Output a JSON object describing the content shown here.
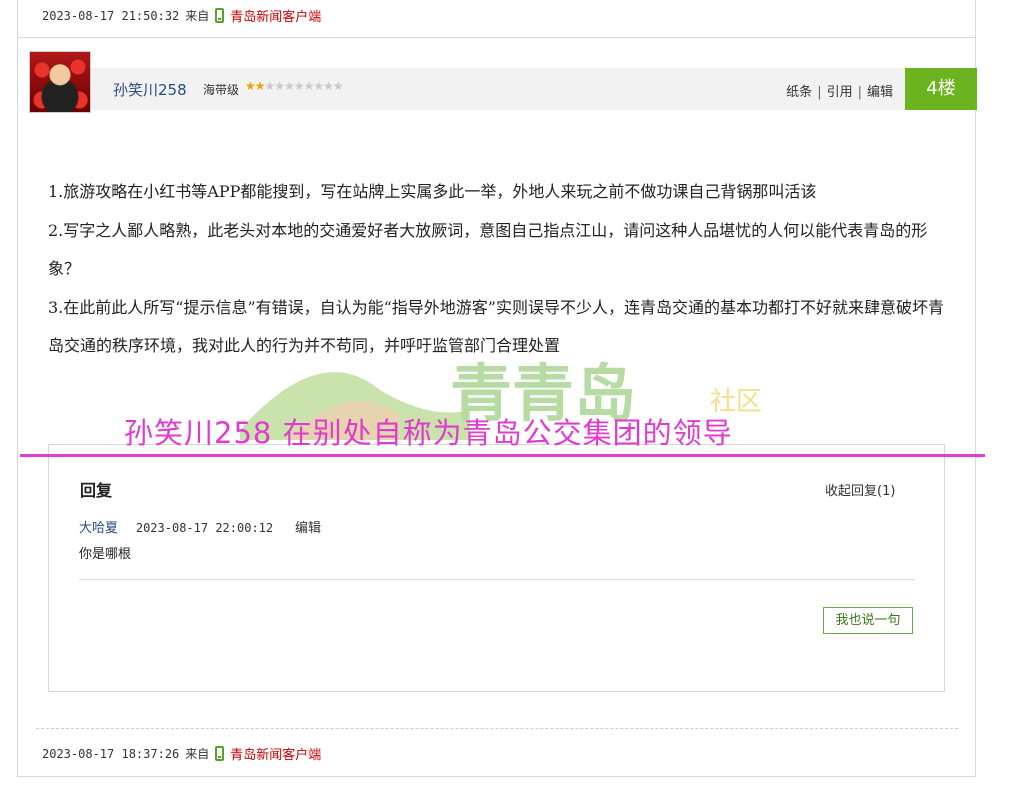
{
  "prev_footer": {
    "timestamp": "2023-08-17 21:50:32",
    "from": "来自",
    "client": "青岛新闻客户端"
  },
  "post": {
    "username": "孙笑川258",
    "rank": "海带级",
    "stars": {
      "filled": 2,
      "total": 10
    },
    "actions": [
      "纸条",
      "引用",
      "编辑"
    ],
    "floor": "4楼",
    "paragraphs": [
      "1.旅游攻略在小红书等APP都能搜到，写在站牌上实属多此一举，外地人来玩之前不做功课自己背锅那叫活该",
      "2.写字之人鄙人略熟，此老头对本地的交通爱好者大放厥词，意图自己指点江山，请问这种人品堪忧的人何以能代表青岛的形象？",
      "3.在此前此人所写“提示信息”有错误，自认为能“指导外地游客”实则误导不少人，连青岛交通的基本功都打不好就来肆意破坏青岛交通的秩序环境，我对此人的行为并不苟同，并呼吁监管部门合理处置"
    ],
    "watermark": {
      "logo": "青青岛",
      "sub": "社区"
    }
  },
  "annotation": {
    "text": "孙笑川258 在别处自称为青岛公交集团的领导",
    "color": "#e03ad0"
  },
  "replies": {
    "title": "回复",
    "collapse": "收起回复(1)",
    "items": [
      {
        "author": "大哈夏",
        "timestamp": "2023-08-17 22:00:12",
        "edit": "编辑",
        "text": "你是哪根"
      }
    ],
    "say_button": "我也说一句"
  },
  "footer": {
    "timestamp": "2023-08-17 18:37:26",
    "from": "来自",
    "client": "青岛新闻客户端"
  },
  "colors": {
    "floor_bg": "#6cb320",
    "client": "#cc0000",
    "username": "#2b4c7e"
  }
}
